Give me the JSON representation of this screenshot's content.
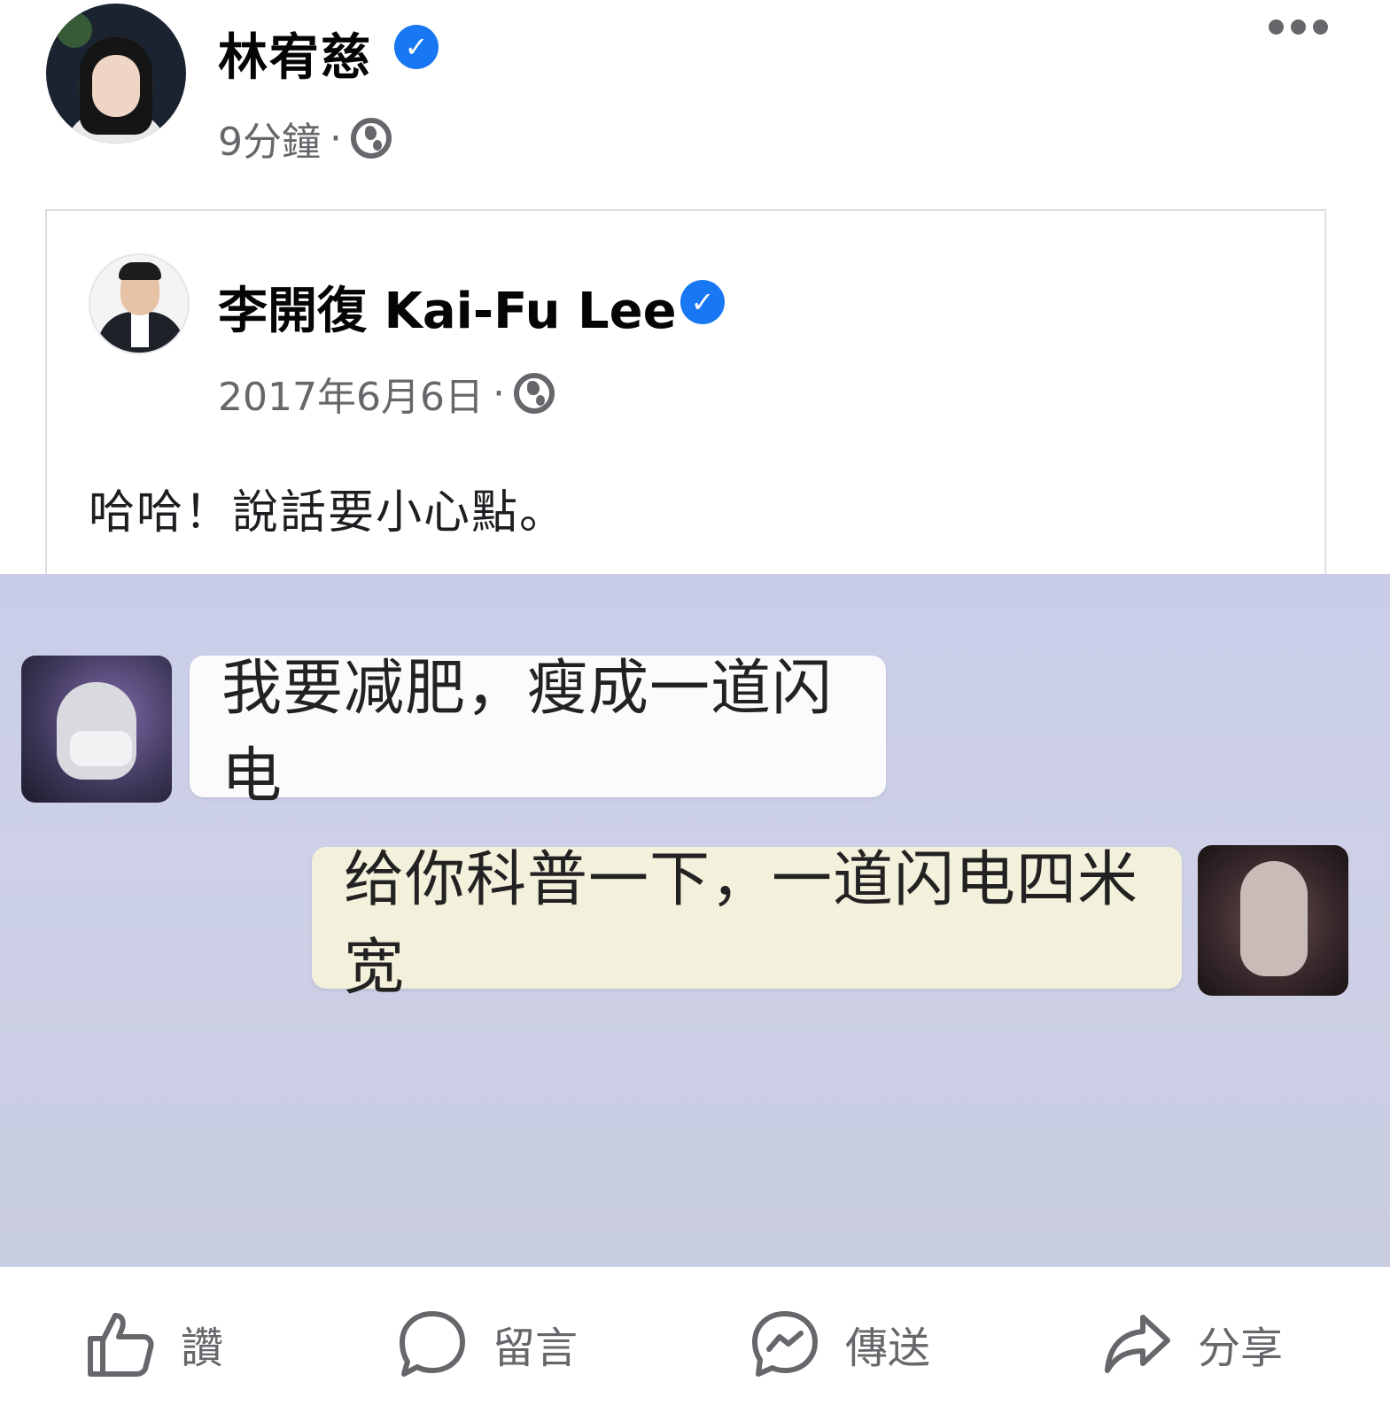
{
  "post": {
    "author": "林宥慈",
    "time": "9分鐘",
    "separator": "·"
  },
  "shared_post": {
    "author": "李開復 Kai-Fu Lee",
    "date": "2017年6月6日",
    "separator": "·",
    "text": "哈哈！說話要小心點。"
  },
  "chat_image": {
    "message_left": "我要减肥，瘦成一道闪电",
    "message_right": "给你科普一下，一道闪电四米宽"
  },
  "actions": {
    "like": "讚",
    "comment": "留言",
    "send": "傳送",
    "share": "分享"
  },
  "icons": {
    "verified": "verified-badge-icon",
    "audience": "globe-icon",
    "more": "more-options-icon",
    "like": "thumbs-up-icon",
    "comment": "comment-bubble-icon",
    "send": "messenger-icon",
    "share": "share-arrow-icon"
  },
  "colors": {
    "verified": "#1877f2",
    "secondary_text": "#65676b"
  }
}
